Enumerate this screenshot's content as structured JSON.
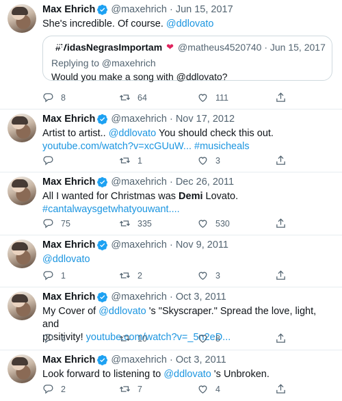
{
  "author": {
    "name": "Max Ehrich",
    "handle": "@maxehrich"
  },
  "icons": {
    "reply": "reply-icon",
    "retweet": "retweet-icon",
    "like": "heart-icon",
    "share": "share-icon",
    "verified": "verified-badge-icon"
  },
  "colors": {
    "link": "#1b95e0",
    "meta": "#536471",
    "verified": "#1da1f2",
    "divider": "#e6ecf0"
  },
  "tweets": [
    {
      "date": "· Jun 15, 2017",
      "parts": [
        "She's incredible. Of course. ",
        "@ddlovato"
      ],
      "quote": {
        "name": "#VidasNegrasImportam",
        "handle": "@matheus4520740 · Jun 15, 2017",
        "replying": "Replying to @maxehrich",
        "text": "Would you make a song with @ddlovato?"
      },
      "replies": "8",
      "retweets": "64",
      "likes": "111"
    },
    {
      "date": "· Nov 17, 2012",
      "line1": [
        "Artist to artist.. ",
        "@ddlovato",
        " You should check this out."
      ],
      "line2": [
        "youtube.com/watch?v=xcGUuW...",
        " ",
        "#musicheals"
      ],
      "replies": "",
      "retweets": "1",
      "likes": "3"
    },
    {
      "date": "· Dec 26, 2011",
      "line1": [
        "All I wanted for Christmas was ",
        "Demi",
        " Lovato."
      ],
      "line2": [
        "#cantalwaysgetwhatyouwant...."
      ],
      "replies": "75",
      "retweets": "335",
      "likes": "530"
    },
    {
      "date": "· Nov 9, 2011",
      "line1": [
        "@ddlovato"
      ],
      "replies": "1",
      "retweets": "2",
      "likes": "3"
    },
    {
      "date": "· Oct 3, 2011",
      "line1": [
        "My Cover of ",
        "@ddlovato",
        " 's \"Skyscraper.\" Spread the love, light, and"
      ],
      "line2": [
        "positivity! ",
        "youtube.com/watch?v=_5n2eD..."
      ],
      "replies": "6",
      "retweets": "10",
      "likes": "8"
    },
    {
      "date": "· Oct 3, 2011",
      "line1": [
        "Look forward to listening to ",
        "@ddlovato",
        " 's Unbroken."
      ],
      "replies": "2",
      "retweets": "7",
      "likes": "4"
    }
  ]
}
